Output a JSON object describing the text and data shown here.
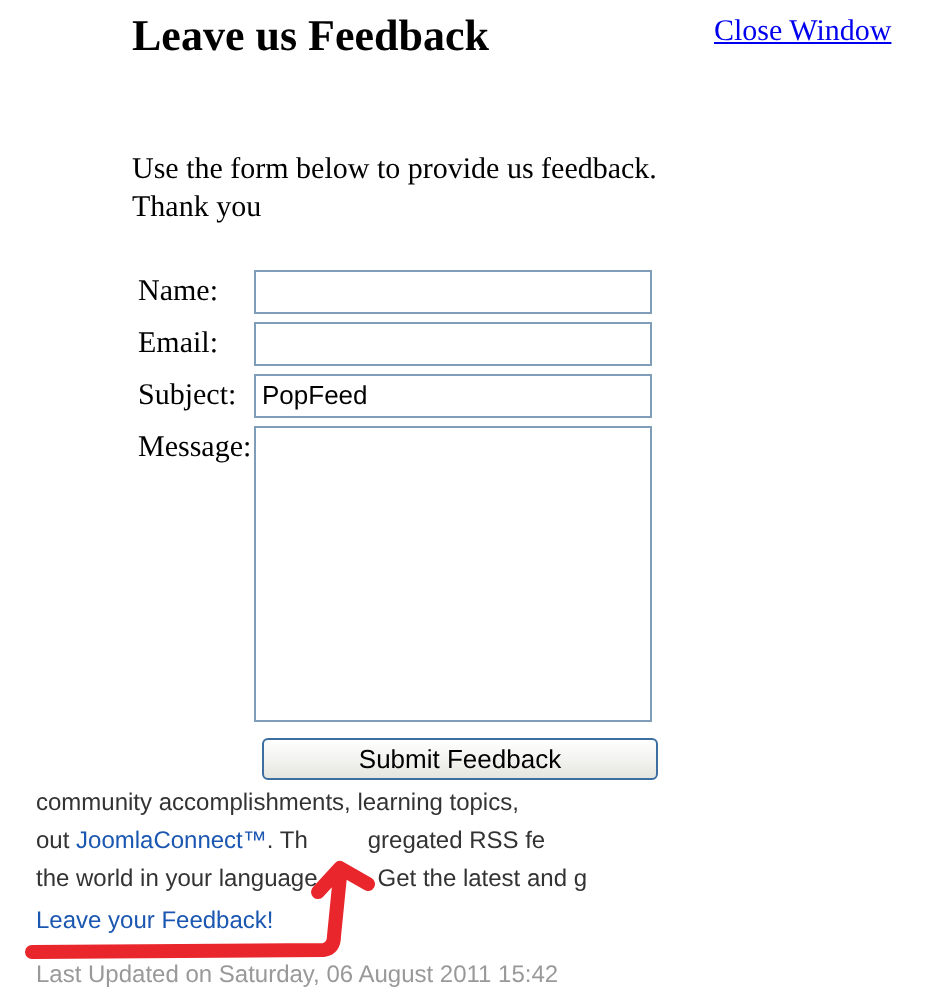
{
  "popup": {
    "title": "Leave us Feedback",
    "close_link": "Close Window",
    "intro_lines": [
      "Use the form below to provide us feedback.",
      "Thank you"
    ],
    "fields": [
      {
        "label": "Name:",
        "kind": "text"
      },
      {
        "label": "Email:",
        "kind": "text"
      },
      {
        "label": "Subject:",
        "kind": "text",
        "value": "PopFeed"
      },
      {
        "label": "Message:",
        "kind": "textarea"
      }
    ],
    "submit_button": "Submit Feedback"
  },
  "background_page": {
    "lines": [
      [
        {
          "kind": "text",
          "text": "community accomplishments, learning topics,"
        }
      ],
      [
        {
          "kind": "text",
          "text": "out "
        },
        {
          "kind": "link",
          "text": "JoomlaConnect™"
        },
        {
          "kind": "text",
          "text": ". Th"
        },
        {
          "kind": "gap"
        },
        {
          "kind": "text",
          "text": "gregated RSS fe"
        }
      ],
      [
        {
          "kind": "text",
          "text": "the world in your language"
        },
        {
          "kind": "gap"
        },
        {
          "kind": "text",
          "text": "Get the latest and g"
        }
      ]
    ],
    "feedback_link": "Leave your Feedback!",
    "last_updated": "Last Updated on Saturday, 06 August 2011 15:42"
  }
}
